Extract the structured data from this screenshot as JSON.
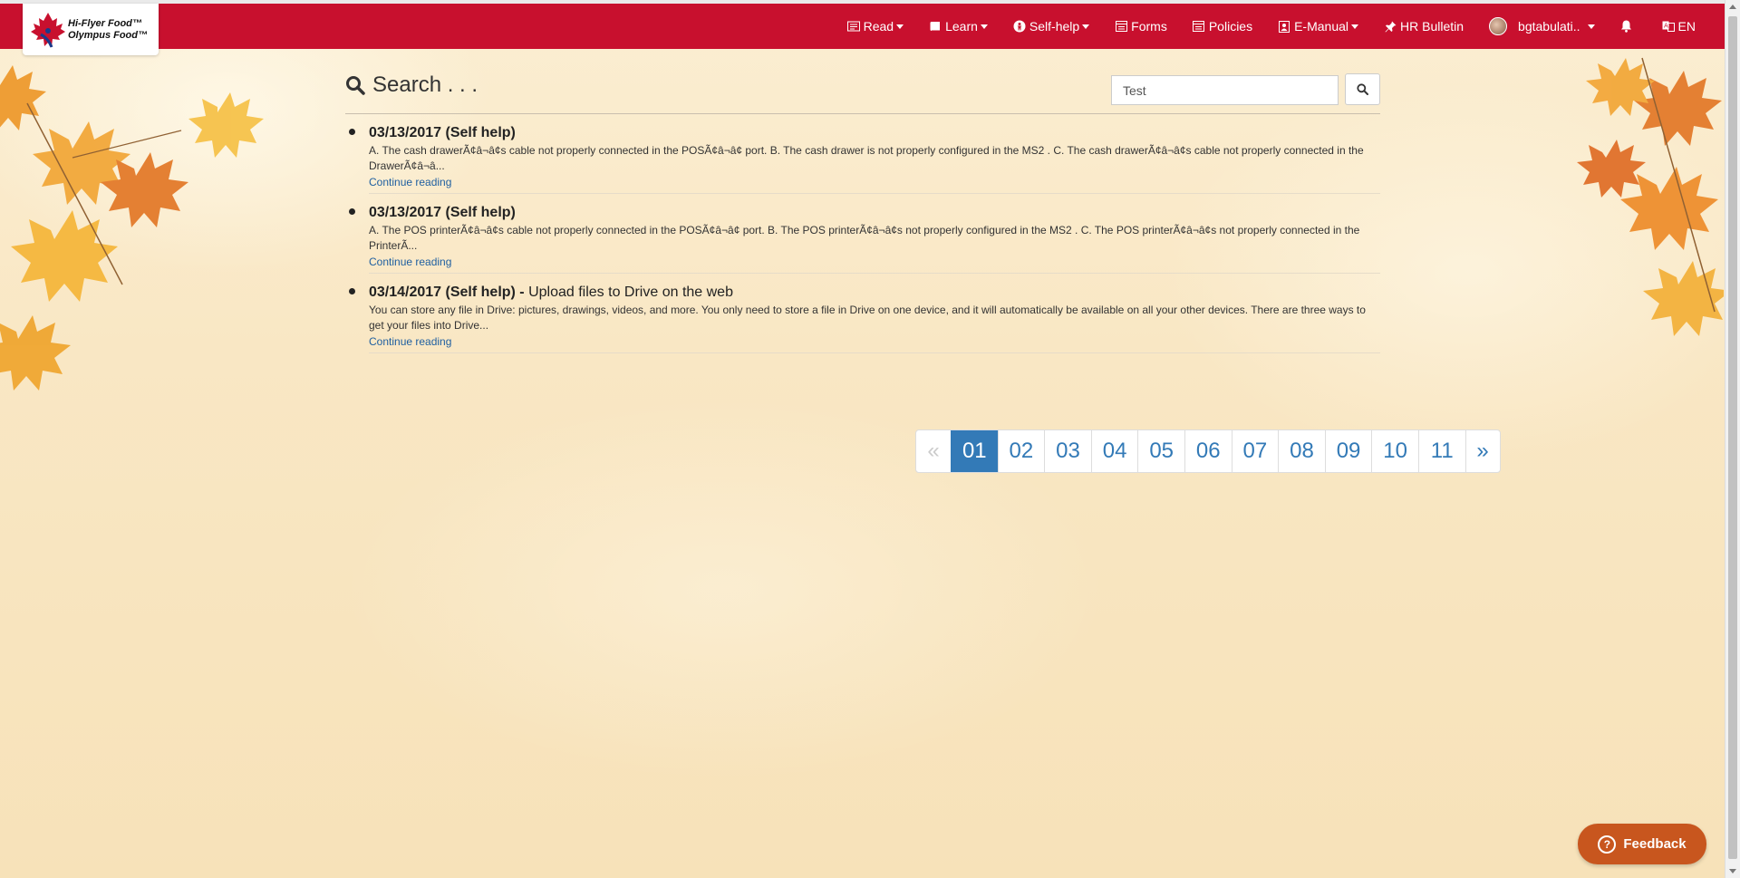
{
  "brand": {
    "line1": "Hi-Flyer Food™",
    "line2": "Olympus Food™"
  },
  "nav": {
    "read": "Read",
    "learn": "Learn",
    "selfhelp": "Self-help",
    "forms": "Forms",
    "policies": "Policies",
    "emanual": "E-Manual",
    "hrbulletin": "HR Bulletin",
    "user": "bgtabulati..",
    "language": "EN"
  },
  "search": {
    "title": "Search . . .",
    "query": "Test"
  },
  "results": [
    {
      "title": "03/13/2017 (Self help)",
      "subtitle": "",
      "snippet": "A. The cash drawerÃ¢â¬â¢s cable not properly connected in the POSÃ¢â¬â¢ port. B. The cash drawer is not properly configured in the MS2 . C. The cash drawerÃ¢â¬â¢s cable not properly connected in the DrawerÃ¢â¬â...",
      "link": "Continue reading"
    },
    {
      "title": "03/13/2017 (Self help)",
      "subtitle": "",
      "snippet": "A. The POS printerÃ¢â¬â¢s cable not properly connected in the POSÃ¢â¬â¢ port. B. The POS printerÃ¢â¬â¢s not properly configured in the MS2 . C. The POS printerÃ¢â¬â¢s not properly connected in the PrinterÃ...",
      "link": "Continue reading"
    },
    {
      "title": "03/14/2017 (Self help) - ",
      "subtitle": "Upload files to Drive on the web",
      "snippet": "You can store any file in Drive: pictures, drawings, videos, and more. You only need to store a file in Drive on one device, and it will automatically be available on all your other devices. There are three ways to get your files into Drive...",
      "link": "Continue reading"
    }
  ],
  "pagination": {
    "prev": "«",
    "next": "»",
    "pages": [
      "01",
      "02",
      "03",
      "04",
      "05",
      "06",
      "07",
      "08",
      "09",
      "10",
      "11"
    ],
    "current": "01"
  },
  "feedback": {
    "label": "Feedback",
    "icon": "?"
  },
  "colors": {
    "navbar": "#c8102e",
    "link": "#337ab7",
    "feedback": "#c8561e"
  }
}
